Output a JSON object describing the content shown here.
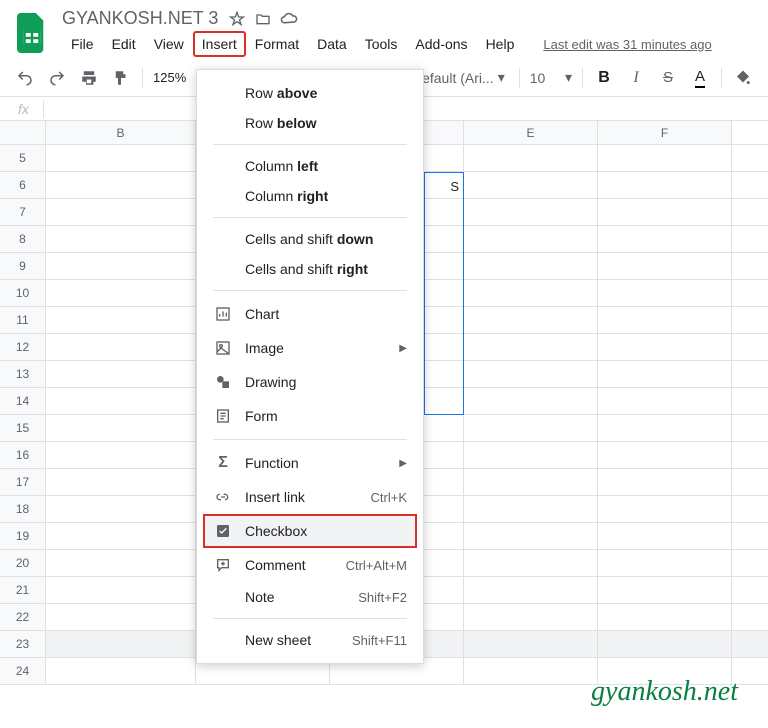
{
  "doc": {
    "title": "GYANKOSH.NET 3"
  },
  "menubar": {
    "file": "File",
    "edit": "Edit",
    "view": "View",
    "insert": "Insert",
    "format": "Format",
    "data": "Data",
    "tools": "Tools",
    "addons": "Add-ons",
    "help": "Help",
    "last_edit": "Last edit was 31 minutes ago"
  },
  "toolbar": {
    "zoom": "125%",
    "font": "Default (Ari...",
    "size": "10"
  },
  "columns": {
    "B": "B",
    "E": "E",
    "F": "F"
  },
  "rows": [
    "5",
    "6",
    "7",
    "8",
    "9",
    "10",
    "11",
    "12",
    "13",
    "14",
    "15",
    "16",
    "17",
    "18",
    "19",
    "20",
    "21",
    "22",
    "23",
    "24"
  ],
  "insert_menu": {
    "row_above_pre": "Row ",
    "row_above_b": "above",
    "row_below_pre": "Row ",
    "row_below_b": "below",
    "col_left_pre": "Column ",
    "col_left_b": "left",
    "col_right_pre": "Column ",
    "col_right_b": "right",
    "cells_down_pre": "Cells and shift ",
    "cells_down_b": "down",
    "cells_right_pre": "Cells and shift ",
    "cells_right_b": "right",
    "chart": "Chart",
    "image": "Image",
    "drawing": "Drawing",
    "form": "Form",
    "function": "Function",
    "insert_link": "Insert link",
    "insert_link_sc": "Ctrl+K",
    "checkbox": "Checkbox",
    "comment": "Comment",
    "comment_sc": "Ctrl+Alt+M",
    "note": "Note",
    "note_sc": "Shift+F2",
    "new_sheet": "New sheet",
    "new_sheet_sc": "Shift+F11"
  },
  "visible_cell": "S",
  "watermark": "gyankosh.net"
}
